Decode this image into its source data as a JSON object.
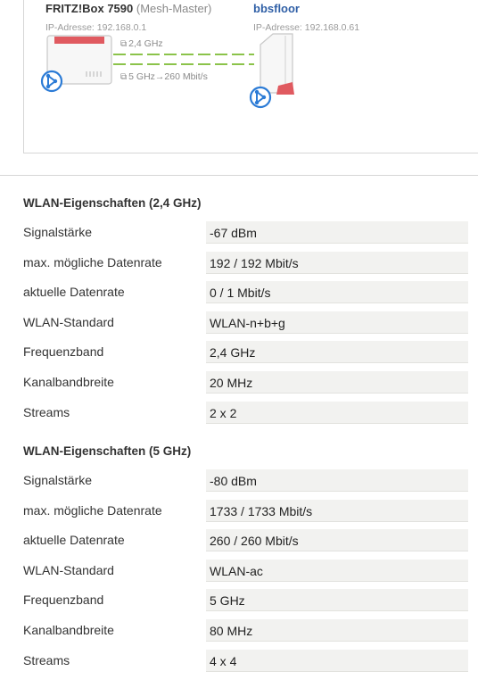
{
  "mesh": {
    "master": {
      "name": "FRITZ!Box 7590",
      "role": "(Mesh-Master)",
      "ip": "IP-Adresse: 192.168.0.1"
    },
    "repeater": {
      "name": "bbsfloor",
      "ip": "IP-Adresse: 192.168.0.61"
    },
    "links": {
      "band_24": "2,4 GHz",
      "band_5": "5 GHz→260 Mbit/s"
    },
    "colors": {
      "link_line": "#8bc34a",
      "mesh_icon": "#2b7bd6",
      "router_accent": "#e05a60"
    }
  },
  "sections": [
    {
      "title": "WLAN-Eigenschaften (2,4 GHz)",
      "rows": [
        {
          "label": "Signalstärke",
          "value": "-67 dBm"
        },
        {
          "label": "max. mögliche Datenrate",
          "value": "192 / 192 Mbit/s"
        },
        {
          "label": "aktuelle Datenrate",
          "value": "0 / 1 Mbit/s"
        },
        {
          "label": "WLAN-Standard",
          "value": "WLAN-n+b+g"
        },
        {
          "label": "Frequenzband",
          "value": "2,4 GHz"
        },
        {
          "label": "Kanalbandbreite",
          "value": "20 MHz"
        },
        {
          "label": "Streams",
          "value": "2 x 2"
        }
      ]
    },
    {
      "title": "WLAN-Eigenschaften (5 GHz)",
      "rows": [
        {
          "label": "Signalstärke",
          "value": "-80 dBm"
        },
        {
          "label": "max. mögliche Datenrate",
          "value": "1733 / 1733 Mbit/s"
        },
        {
          "label": "aktuelle Datenrate",
          "value": "260 / 260 Mbit/s"
        },
        {
          "label": "WLAN-Standard",
          "value": "WLAN-ac"
        },
        {
          "label": "Frequenzband",
          "value": "5 GHz"
        },
        {
          "label": "Kanalbandbreite",
          "value": "80 MHz"
        },
        {
          "label": "Streams",
          "value": "4 x 4"
        }
      ]
    }
  ]
}
